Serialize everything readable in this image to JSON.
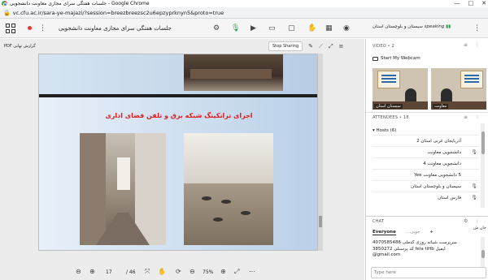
{
  "window": {
    "title": "جلسات هفتگی سرای مجازی معاونت دانشجویی - Google Chrome",
    "controls": [
      "—",
      "□",
      "✕"
    ]
  },
  "address_bar": {
    "url": "vc.cfu.ac.ir/sara-ye-majazi/?session=breezbreezsc2u6epzyprknyn5&proto=true"
  },
  "toolbar": {
    "meeting_title": "جلسات هفتگی سرای مجازی معاونت دانشجویی",
    "speaking_name": "سیستان و بلوچستان استان",
    "speaking_label": "speaking",
    "icons": [
      "grid-icon",
      "record-icon",
      "settings-icon",
      "mic-icon",
      "video-icon",
      "share-icon",
      "hand-icon",
      "layout-icon",
      "person-icon",
      "more-icon"
    ]
  },
  "presentation": {
    "file_label": "PDF گزارش نهایی",
    "stop_sharing": "Stop Sharing",
    "slide_heading": "اجرای ترانکینگ شبکه برق و تلفن فضای اداری",
    "page_current": "17",
    "page_total": "/ 46",
    "zoom": "75%"
  },
  "video_pod": {
    "title": "VIDEO",
    "count": "2",
    "webcam_button": "Start My Webcam",
    "feeds": [
      {
        "label": "سیستان استان"
      },
      {
        "label": "معاونت"
      }
    ]
  },
  "attendees": {
    "title": "ATTENDEES",
    "count": "18",
    "hosts_label": "Hosts (6)",
    "rows": [
      {
        "name": "آذربایجان غربی استان 2",
        "mic": false
      },
      {
        "name": "دانشجویی معاونت",
        "mic": true
      },
      {
        "name": "دانشجویی معاونت 4",
        "mic": false
      },
      {
        "name": "5 دانشجویی معاونت Yee",
        "mic": false
      },
      {
        "name": "سیستان و بلوچستان استان",
        "mic": true
      },
      {
        "name": "فارس استان",
        "mic": true
      }
    ]
  },
  "chat": {
    "title": "CHAT",
    "tab_everyone": "Everyone",
    "tab_second": "جوبی...",
    "add_tab": "+",
    "partial_text": "جان ش",
    "message": "سرپرست شبانه روزی کدملی 4070585486 کد پرسنلی 3850272 fela tiHb ایمیل @gmail.com",
    "input_placeholder": "Type here"
  }
}
